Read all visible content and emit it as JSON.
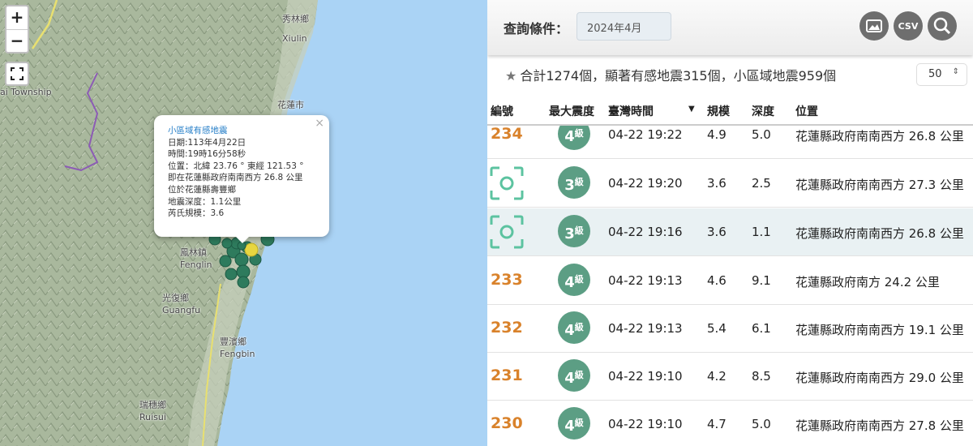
{
  "map": {
    "zoom_in": "+",
    "zoom_out": "−",
    "places": [
      {
        "zh": "秀林鄉",
        "en": "Xiulin"
      },
      {
        "zh": "",
        "en": "ai Township"
      },
      {
        "zh": "花蓮市",
        "en": ""
      },
      {
        "zh": "鳳林鎮",
        "en": "Fenglin"
      },
      {
        "zh": "光復鄉",
        "en": "Guangfu"
      },
      {
        "zh": "豐濱鄉",
        "en": "Fengbin"
      },
      {
        "zh": "瑞穗鄉",
        "en": "Ruisui"
      }
    ],
    "popup": {
      "title": "小區域有感地震",
      "close": "×",
      "lines": [
        "日期:113年4月22日",
        "時間:19時16分58秒",
        "位置：北緯 23.76 ° 東經 121.53 °",
        "即在花蓮縣政府南南西方 26.8 公里",
        "位於花蓮縣壽豐鄉",
        "地震深度：1.1公里",
        "芮氏規模：3.6"
      ]
    }
  },
  "panel": {
    "query_label": "查詢條件：",
    "query_value": "2024年4月",
    "buttons": {
      "image": "image-icon",
      "csv": "CSV",
      "search": "search-icon"
    },
    "summary": "合計1274個，顯著有感地震315個，小區域地震959個",
    "per_page": "50",
    "columns": [
      "編號",
      "最大震度",
      "臺灣時間",
      "規模",
      "深度",
      "位置"
    ],
    "rows": [
      {
        "id": "234",
        "intensity": "4",
        "unit": "級",
        "time": "04-22 19:22",
        "mag": "4.9",
        "depth": "5.0",
        "loc": "花蓮縣政府南南西方 26.8 公里"
      },
      {
        "id": "",
        "intensity": "3",
        "unit": "級",
        "time": "04-22 19:20",
        "mag": "3.6",
        "depth": "2.5",
        "loc": "花蓮縣政府南南西方 27.3 公里"
      },
      {
        "id": "",
        "intensity": "3",
        "unit": "級",
        "time": "04-22 19:16",
        "mag": "3.6",
        "depth": "1.1",
        "loc": "花蓮縣政府南南西方 26.8 公里"
      },
      {
        "id": "233",
        "intensity": "4",
        "unit": "級",
        "time": "04-22 19:13",
        "mag": "4.6",
        "depth": "9.1",
        "loc": "花蓮縣政府南方 24.2 公里"
      },
      {
        "id": "232",
        "intensity": "4",
        "unit": "級",
        "time": "04-22 19:13",
        "mag": "5.4",
        "depth": "6.1",
        "loc": "花蓮縣政府南南西方 19.1 公里"
      },
      {
        "id": "231",
        "intensity": "4",
        "unit": "級",
        "time": "04-22 19:10",
        "mag": "4.2",
        "depth": "8.5",
        "loc": "花蓮縣政府南南西方 29.0 公里"
      },
      {
        "id": "230",
        "intensity": "4",
        "unit": "級",
        "time": "04-22 19:10",
        "mag": "4.7",
        "depth": "5.0",
        "loc": "花蓮縣政府南南西方 27.8 公里"
      }
    ]
  }
}
